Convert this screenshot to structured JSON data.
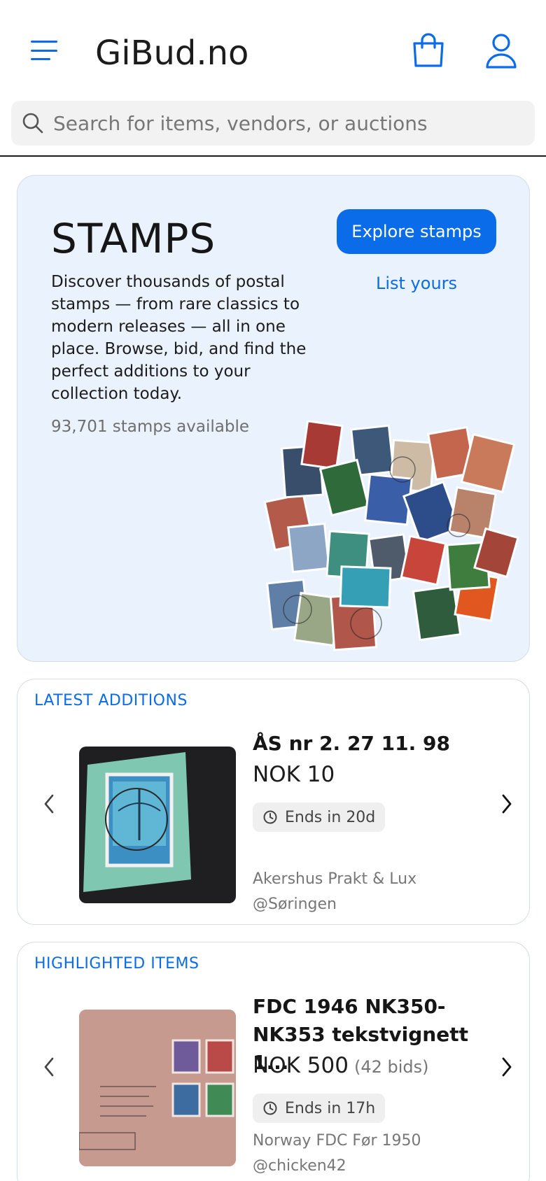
{
  "header": {
    "brand": "GiBud.no",
    "menu_icon": "hamburger-menu-icon",
    "cart_icon": "shopping-bag-icon",
    "user_icon": "user-icon"
  },
  "search": {
    "placeholder": "Search for items, vendors, or auctions",
    "value": ""
  },
  "hero": {
    "title": "STAMPS",
    "description": "Discover thousands of postal stamps — from rare classics to modern releases — all in one place. Browse, bid, and find the perfect additions to your collection today.",
    "count": "93,701 stamps available",
    "explore_label": "Explore stamps",
    "list_label": "List yours"
  },
  "latest": {
    "heading": "LATEST ADDITIONS",
    "item": {
      "title": "ÅS nr 2. 27 11. 98",
      "price": "NOK 10",
      "bids": "",
      "ends": "Ends in 20d",
      "seller": "Akershus Prakt & Lux",
      "handle": "@Søringen"
    }
  },
  "highlighted": {
    "heading": "HIGHLIGHTED ITEMS",
    "item": {
      "title": "FDC 1946 NK350-NK353 tekstvignett 1...",
      "price": "NOK 500",
      "bids": "(42 bids)",
      "ends": "Ends in 17h",
      "seller": "Norway FDC Før 1950",
      "handle": "@chicken42"
    }
  },
  "colors": {
    "accent": "#0a6ce8",
    "hero_bg": "#e9f2fd",
    "badge_bg": "#efefef"
  }
}
